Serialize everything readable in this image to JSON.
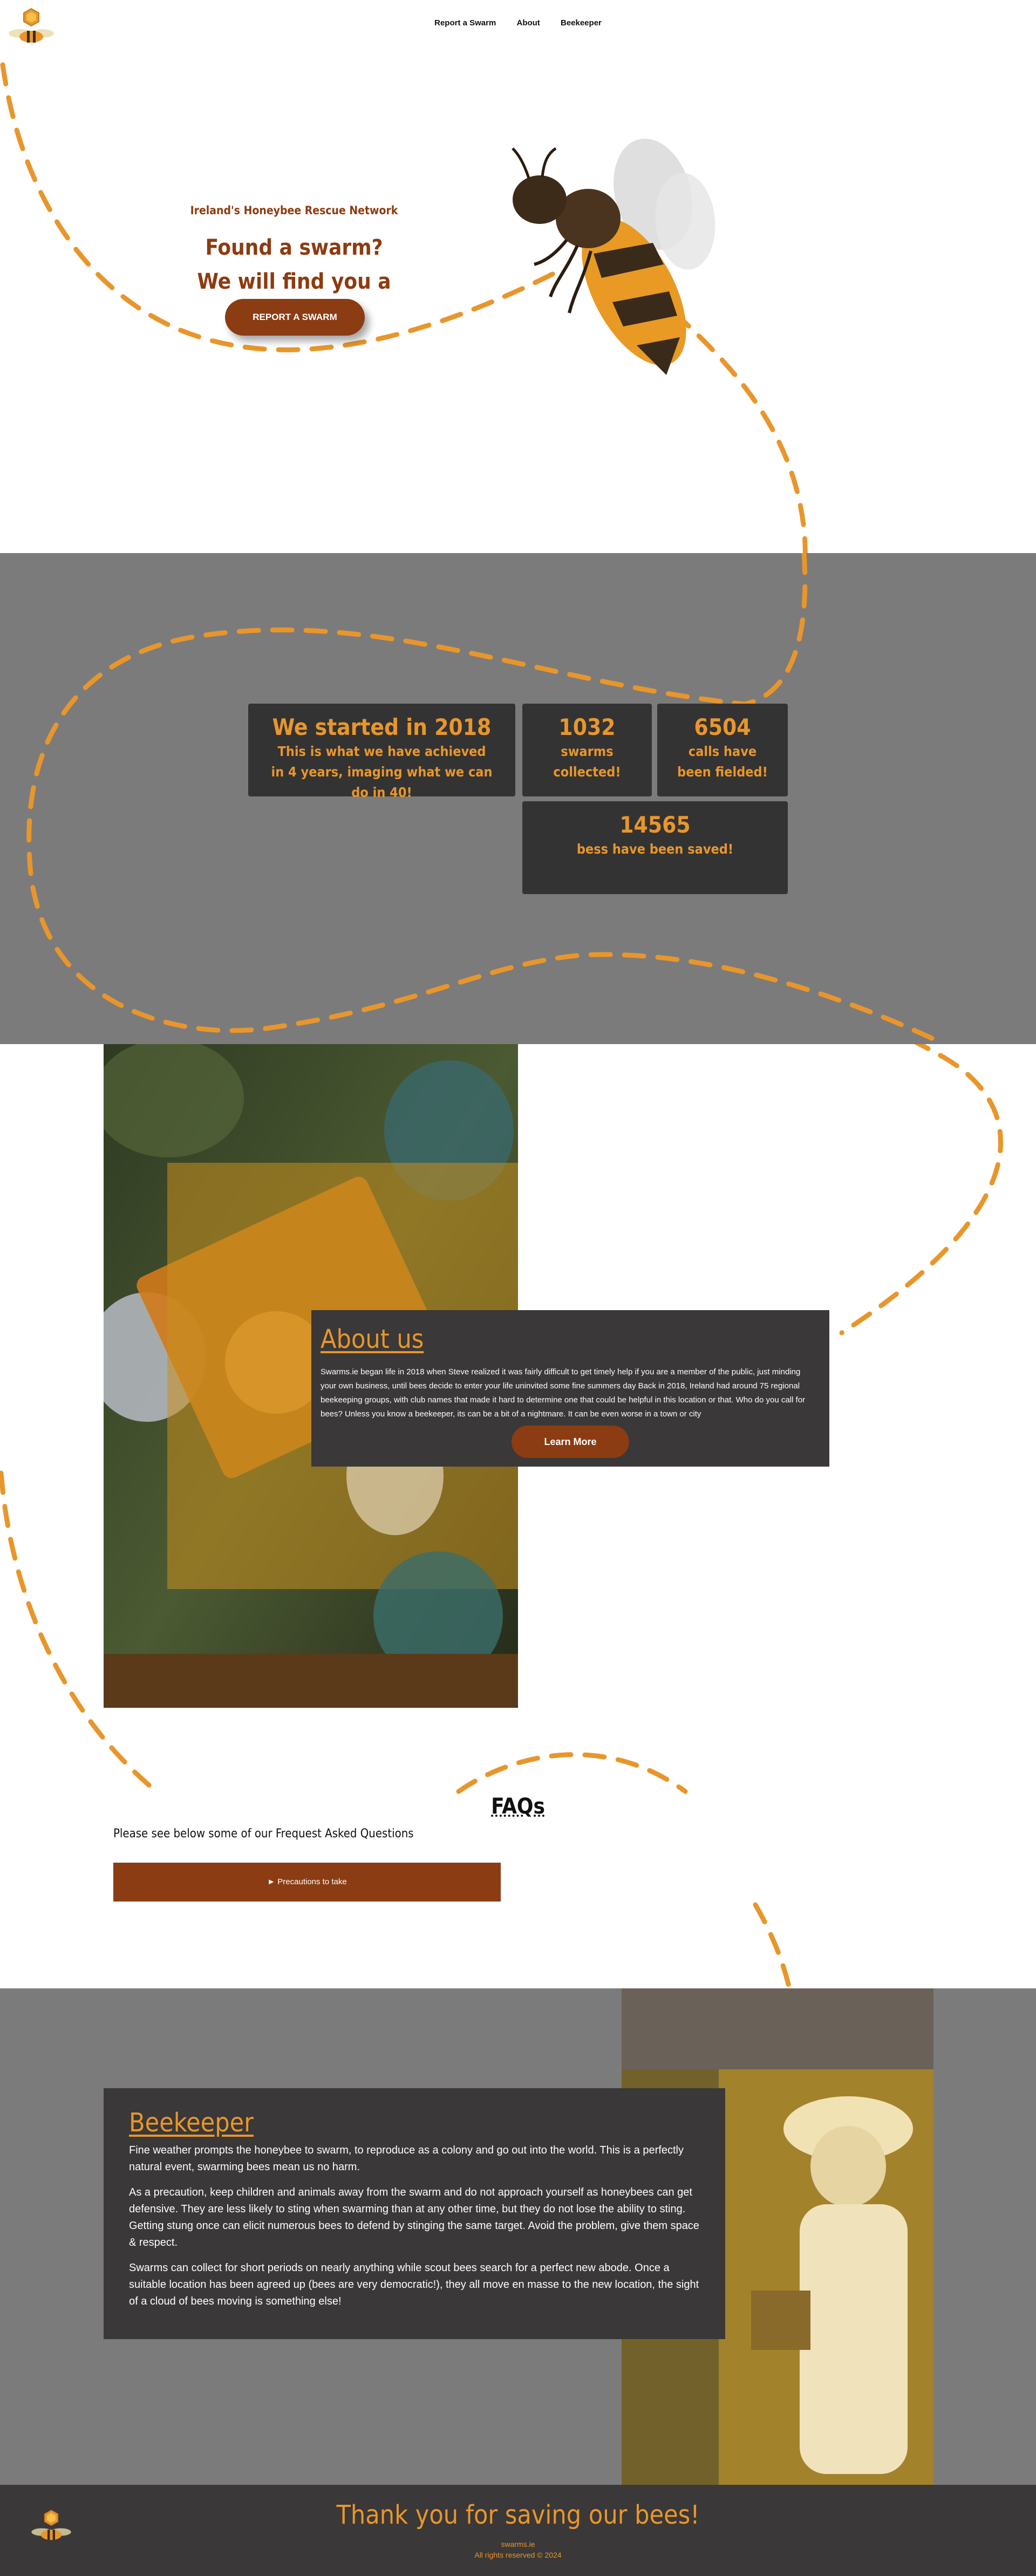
{
  "nav": {
    "items": [
      "Report a Swarm",
      "About",
      "Beekeeper"
    ]
  },
  "hero": {
    "subtitle": "Ireland's Honeybee Rescue Network",
    "title_line1": "Found a swarm?",
    "title_line2": "We will find you a keeper",
    "button": "REPORT A SWARM"
  },
  "stats": {
    "started_title": "We started in 2018",
    "started_text": "This is what we have achieved in 4 years, imaging what we can do in 40!",
    "swarms_value": "1032",
    "swarms_label": "swarms collected!",
    "calls_value": "6504",
    "calls_label": "calls have been fielded!",
    "saved_value": "14565",
    "saved_label": "bess have been saved!"
  },
  "about": {
    "title": "About us",
    "text": "Swarms.ie began life in 2018 when Steve realized it was fairly difficult to get timely help if you are a member of the public, just minding your own business, until bees decide to enter your life uninvited some fine summers day Back in 2018, Ireland had around 75 regional beekeeping groups, with club names that made it hard to determine one that could be helpful in this location or that. Who do you call for bees? Unless you know a beekeeper, its can be a bit of a nightmare. It can be even worse in a town or city",
    "button": "Learn More"
  },
  "faq": {
    "title": "FAQs",
    "subtitle": "Please see below some of our Frequest Asked Questions",
    "items": [
      "► Precautions to take"
    ]
  },
  "beekeeper": {
    "title": "Beekeeper",
    "p1": "Fine weather prompts the honeybee to swarm, to reproduce as a colony and go out into the world. This is a perfectly natural event, swarming bees mean us no harm.",
    "p2": "As a precaution, keep children and animals away from the swarm and do not approach yourself as honeybees can get defensive. They are less likely to sting when swarming than at any other time, but they do not lose the ability to sting. Getting stung once can elicit numerous bees to defend by stinging the same target. Avoid the problem, give them space & respect.",
    "p3": "Swarms can collect for short periods on nearly anything while scout bees search for a perfect new abode. Once a suitable location has been agreed up (bees are very democratic!), they all move en masse to the new location, the sight of a cloud of bees moving is something else!"
  },
  "footer": {
    "title": "Thank you for saving our bees!",
    "link": "swarms.ie",
    "copyright": "All rights reserved © 2024"
  },
  "colors": {
    "accent": "#e8962c",
    "brown": "#8b3c12",
    "panel": "#3a3838",
    "band": "#7b7b7b"
  },
  "icons": {
    "logo": "bee-hex-logo-icon",
    "bee": "bee-illustration"
  }
}
